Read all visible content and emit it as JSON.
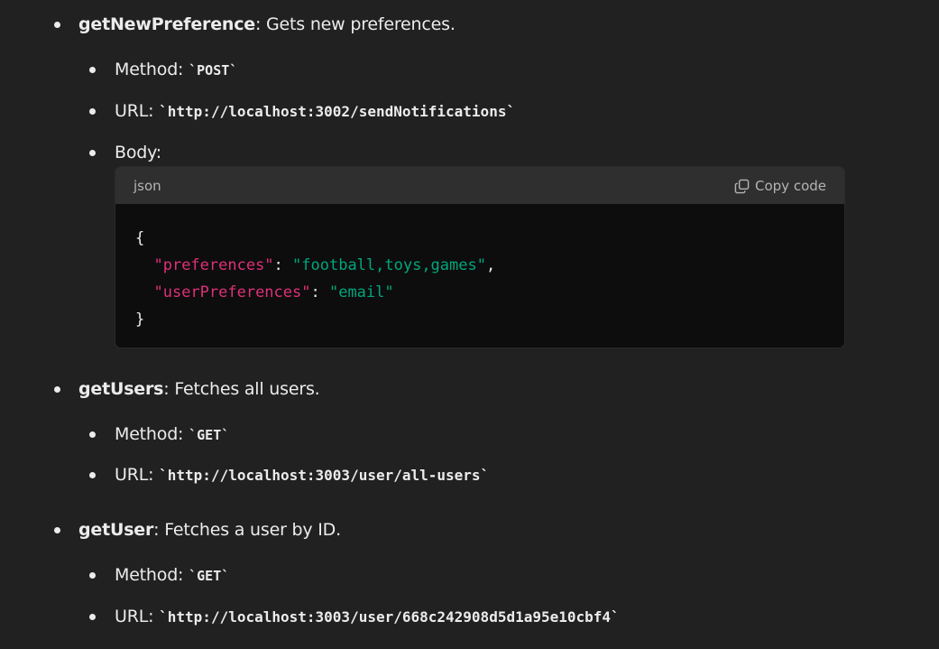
{
  "endpoints": [
    {
      "name": "getNewPreference",
      "description": ": Gets new preferences.",
      "method_label": "Method: ",
      "method": "`POST`",
      "url_label": "URL: ",
      "url": "`http://localhost:3002/sendNotifications`",
      "body_label": "Body:"
    },
    {
      "name": "getUsers",
      "description": ": Fetches all users.",
      "method_label": "Method: ",
      "method": "`GET`",
      "url_label": "URL: ",
      "url": "`http://localhost:3003/user/all-users`"
    },
    {
      "name": "getUser",
      "description": ": Fetches a user by ID.",
      "method_label": "Method: ",
      "method": "`GET`",
      "url_label": "URL: ",
      "url": "`http://localhost:3003/user/668c242908d5d1a95e10cbf4`"
    }
  ],
  "codeblock": {
    "language": "json",
    "copy_label": "Copy code",
    "open_brace": "{",
    "close_brace": "}",
    "line1_key": "\"preferences\"",
    "line1_sep": ": ",
    "line1_value": "\"football,toys,games\"",
    "line1_end": ",",
    "line2_key": "\"userPreferences\"",
    "line2_sep": ": ",
    "line2_value": "\"email\""
  },
  "colors": {
    "background": "#212121",
    "code_bg": "#0d0d0d",
    "code_header_bg": "#2f2f2f",
    "json_key": "#df3079",
    "json_string": "#00a67d"
  },
  "icons": {
    "copy": "copy-icon"
  }
}
